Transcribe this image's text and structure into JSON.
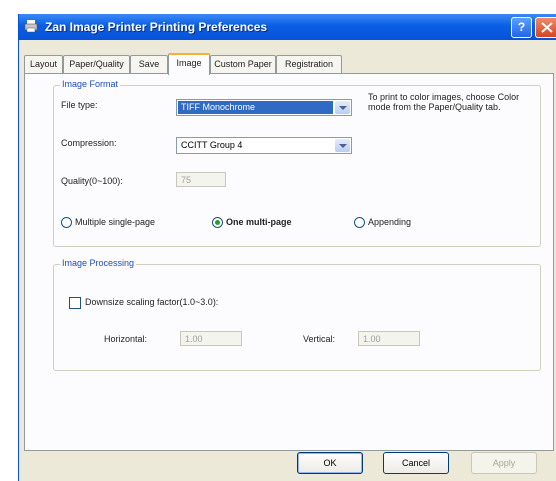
{
  "window": {
    "title": "Zan Image Printer Printing Preferences",
    "help_label": "?"
  },
  "tabs": [
    {
      "label": "Layout"
    },
    {
      "label": "Paper/Quality"
    },
    {
      "label": "Save"
    },
    {
      "label": "Image"
    },
    {
      "label": "Custom Paper"
    },
    {
      "label": "Registration"
    }
  ],
  "active_tab": "Image",
  "image_format": {
    "group_label": "Image Format",
    "file_type_label": "File type:",
    "file_type_value": "TIFF Monochrome",
    "hint": "To print to color images, choose Color mode from the Paper/Quality tab.",
    "compression_label": "Compression:",
    "compression_value": "CCITT Group 4",
    "quality_label": "Quality(0~100):",
    "quality_value": "75",
    "radio_multiple_single": "Multiple single-page",
    "radio_one_multi": "One multi-page",
    "radio_appending": "Appending",
    "selected_radio": "One multi-page"
  },
  "image_processing": {
    "group_label": "Image Processing",
    "downsample_label": "Downsize scaling factor(1.0~3.0):",
    "downsample_checked": false,
    "horizontal_label": "Horizontal:",
    "horizontal_value": "1.00",
    "vertical_label": "Vertical:",
    "vertical_value": "1.00"
  },
  "buttons": {
    "ok": "OK",
    "cancel": "Cancel",
    "apply": "Apply"
  }
}
